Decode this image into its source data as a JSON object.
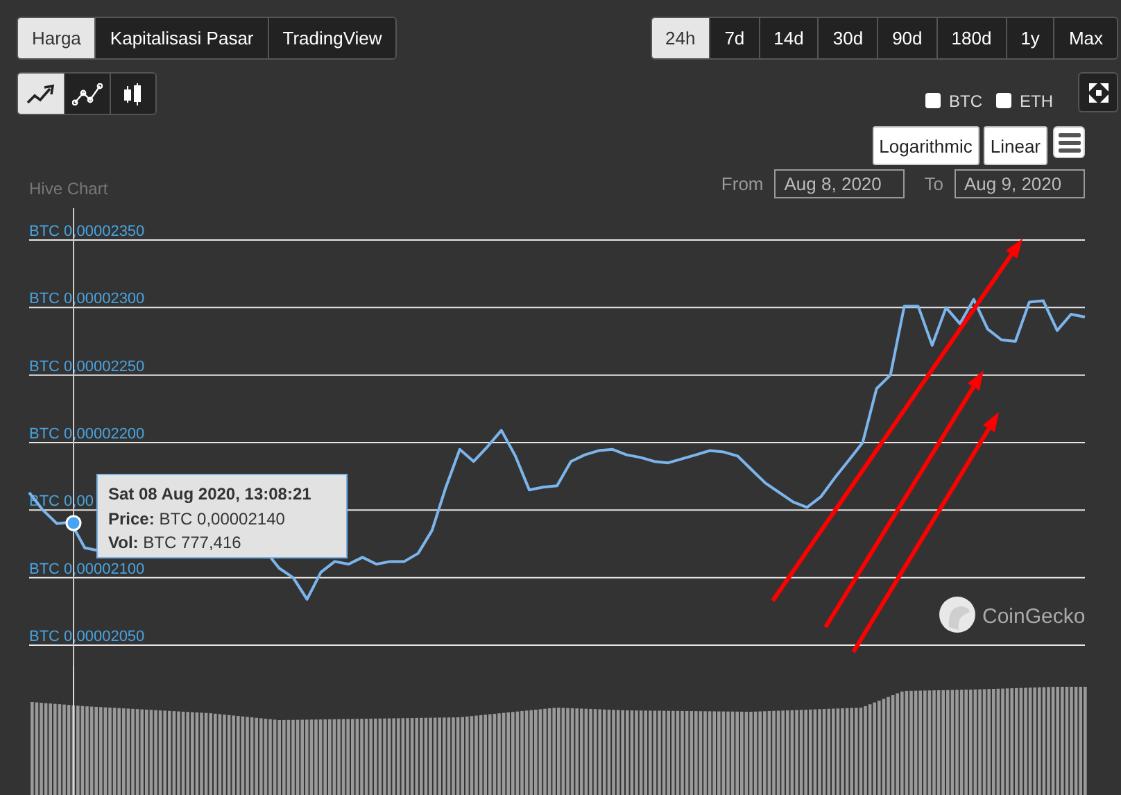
{
  "tabs": [
    {
      "label": "Harga",
      "selected": true
    },
    {
      "label": "Kapitalisasi Pasar",
      "selected": false
    },
    {
      "label": "TradingView",
      "selected": false
    }
  ],
  "ranges": [
    {
      "label": "24h",
      "selected": true
    },
    {
      "label": "7d",
      "selected": false
    },
    {
      "label": "14d",
      "selected": false
    },
    {
      "label": "30d",
      "selected": false
    },
    {
      "label": "90d",
      "selected": false
    },
    {
      "label": "180d",
      "selected": false
    },
    {
      "label": "1y",
      "selected": false
    },
    {
      "label": "Max",
      "selected": false
    }
  ],
  "chart_types": [
    {
      "kind": "line",
      "selected": true
    },
    {
      "kind": "points",
      "selected": false
    },
    {
      "kind": "candles",
      "selected": false
    }
  ],
  "compare": [
    {
      "label": "BTC",
      "checked": false
    },
    {
      "label": "ETH",
      "checked": false
    }
  ],
  "scales": [
    {
      "label": "Logarithmic"
    },
    {
      "label": "Linear"
    }
  ],
  "chart_title": "Hive Chart",
  "date_range": {
    "from_label": "From",
    "from": "Aug 8, 2020",
    "to_label": "To",
    "to": "Aug 9, 2020"
  },
  "y_axis_labels": [
    "BTC 0,00002350",
    "BTC 0,00002300",
    "BTC 0,00002250",
    "BTC 0,00002200",
    "BTC 0,00",
    "BTC 0,00002100",
    "BTC 0,00002050"
  ],
  "tooltip": {
    "date": "Sat 08 Aug 2020, 13:08:21",
    "price_label": "Price:",
    "price": "BTC 0,00002140",
    "vol_label": "Vol:",
    "vol": "BTC 777,416"
  },
  "markup": [
    {
      "kind": "arrow"
    },
    {
      "kind": "arrow"
    },
    {
      "kind": "arrow"
    }
  ],
  "credit": "CoinGecko"
}
